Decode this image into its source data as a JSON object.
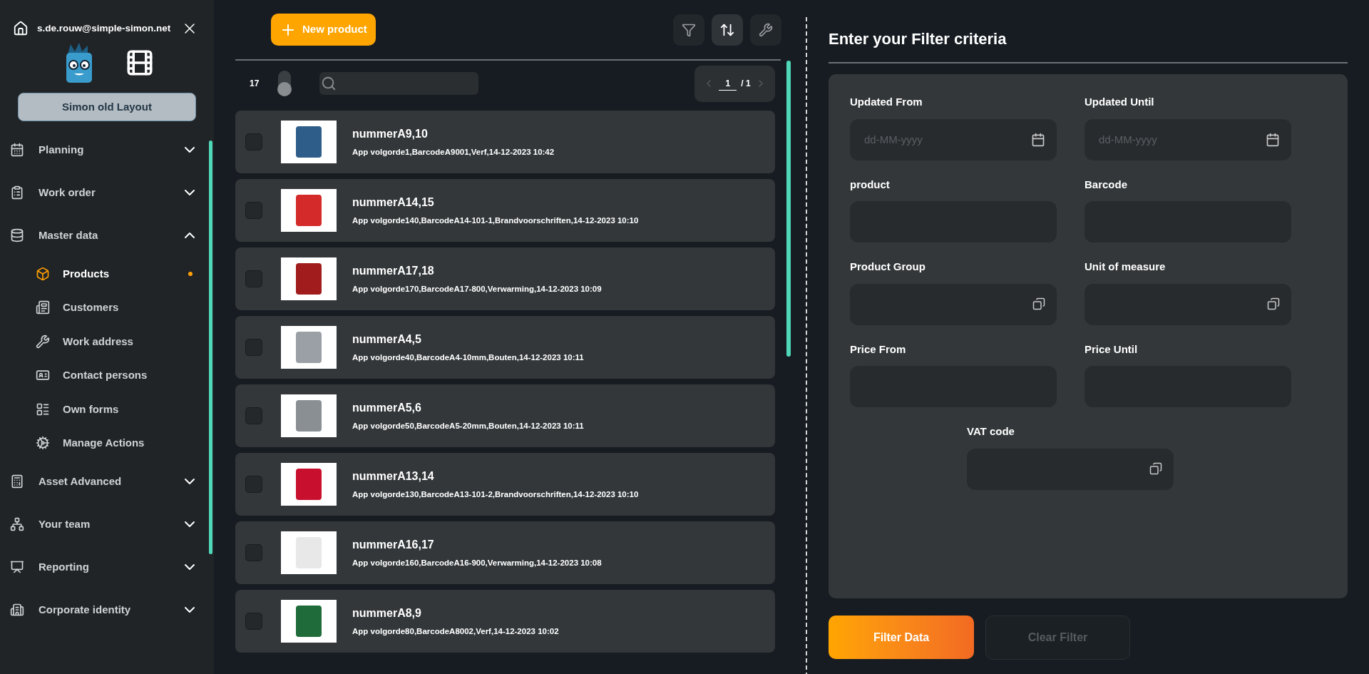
{
  "user": {
    "email": "s.de.rouw@simple-simon.net"
  },
  "layout_button": "Simon old Layout",
  "nav": [
    {
      "label": "Planning",
      "expanded": false
    },
    {
      "label": "Work order",
      "expanded": false
    },
    {
      "label": "Master data",
      "expanded": true,
      "children": [
        {
          "label": "Products",
          "selected": true
        },
        {
          "label": "Customers",
          "selected": false
        },
        {
          "label": "Work address",
          "selected": false
        },
        {
          "label": "Contact persons",
          "selected": false
        },
        {
          "label": "Own forms",
          "selected": false
        },
        {
          "label": "Manage Actions",
          "selected": false
        }
      ]
    },
    {
      "label": "Asset Advanced",
      "expanded": false
    },
    {
      "label": "Your team",
      "expanded": false
    },
    {
      "label": "Reporting",
      "expanded": false
    },
    {
      "label": "Corporate identity",
      "expanded": false
    }
  ],
  "list": {
    "new_button": "New product",
    "tools": [
      {
        "kind": "filter",
        "selected": false
      },
      {
        "kind": "sort",
        "selected": true
      },
      {
        "kind": "wrench",
        "selected": false
      }
    ],
    "count": "17",
    "toggle_on": false,
    "page": "1",
    "page_total": "/ 1",
    "products": [
      {
        "title": "nummerA9,10",
        "details": "App volgorde1,BarcodeA9001,Verf,14-12-2023 10:42",
        "checked": false
      },
      {
        "title": "nummerA14,15",
        "details": "App volgorde140,BarcodeA14-101-1,Brandvoorschriften,14-12-2023 10:10",
        "checked": false
      },
      {
        "title": "nummerA17,18",
        "details": "App volgorde170,BarcodeA17-800,Verwarming,14-12-2023 10:09",
        "checked": false
      },
      {
        "title": "nummerA4,5",
        "details": "App volgorde40,BarcodeA4-10mm,Bouten,14-12-2023 10:11",
        "checked": false
      },
      {
        "title": "nummerA5,6",
        "details": "App volgorde50,BarcodeA5-20mm,Bouten,14-12-2023 10:11",
        "checked": false
      },
      {
        "title": "nummerA13,14",
        "details": "App volgorde130,BarcodeA13-101-2,Brandvoorschriften,14-12-2023 10:10",
        "checked": false
      },
      {
        "title": "nummerA16,17",
        "details": "App volgorde160,BarcodeA16-900,Verwarming,14-12-2023 10:08",
        "checked": false
      },
      {
        "title": "nummerA8,9",
        "details": "App volgorde80,BarcodeA8002,Verf,14-12-2023 10:02",
        "checked": false
      }
    ]
  },
  "filter": {
    "title": "Enter your Filter criteria",
    "fields": [
      {
        "label": "Updated From",
        "kind": "date",
        "placeholder": "dd-MM-yyyy"
      },
      {
        "label": "Updated Until",
        "kind": "date",
        "placeholder": "dd-MM-yyyy"
      },
      {
        "label": "product",
        "kind": "text"
      },
      {
        "label": "Barcode",
        "kind": "text"
      },
      {
        "label": "Product Group",
        "kind": "select"
      },
      {
        "label": "Unit of measure",
        "kind": "select"
      },
      {
        "label": "Price From",
        "kind": "text"
      },
      {
        "label": "Price Until",
        "kind": "text"
      },
      {
        "label": "VAT code",
        "kind": "select"
      }
    ],
    "apply_button": "Filter Data",
    "clear_button": {
      "label": "Clear Filter",
      "disabled": true
    }
  }
}
